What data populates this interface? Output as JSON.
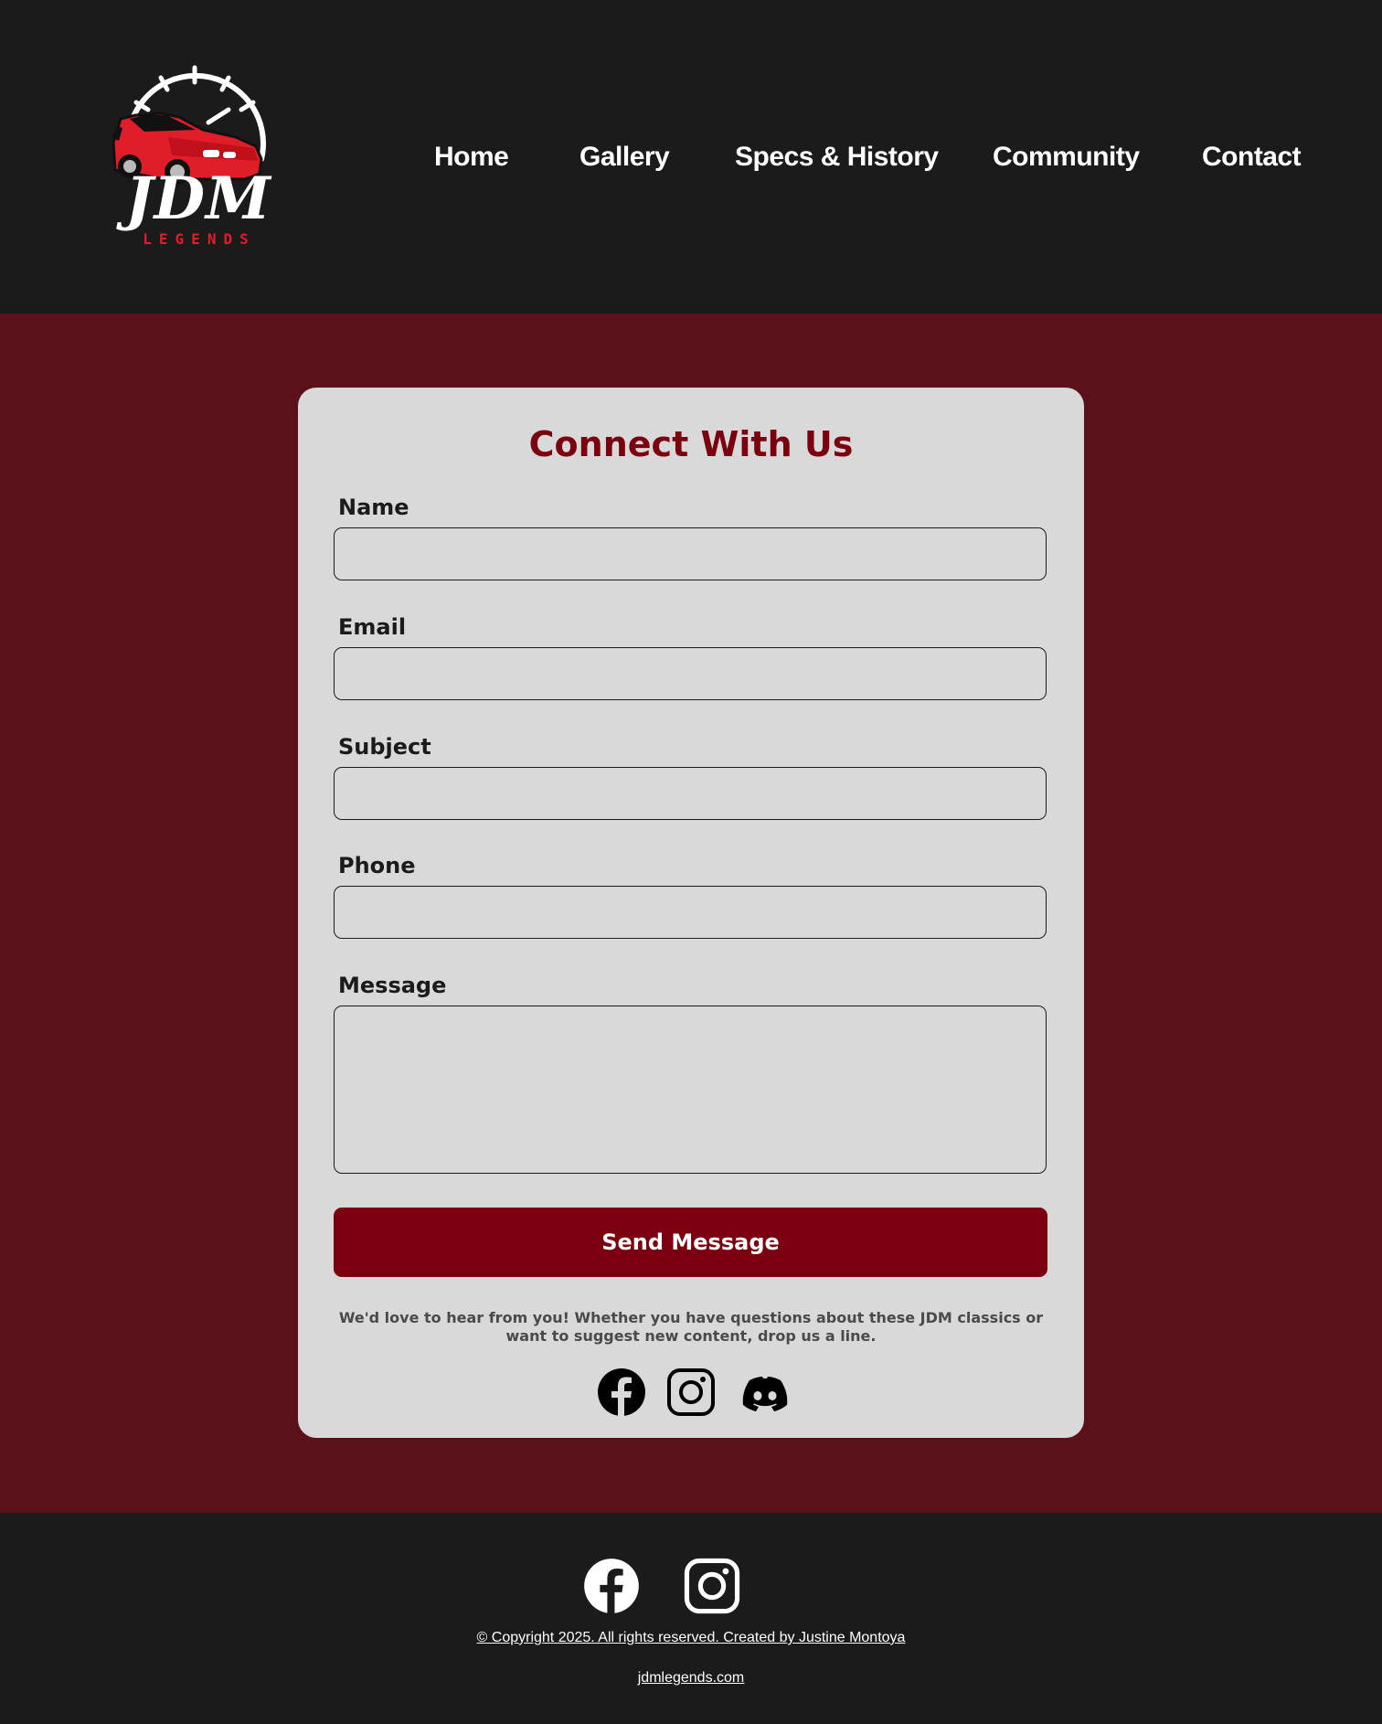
{
  "header": {
    "logo": {
      "title": "JDM",
      "subtitle": "LEGENDS",
      "accent_color": "#e11d2a"
    },
    "nav": [
      {
        "label": "Home"
      },
      {
        "label": "Gallery"
      },
      {
        "label": "Specs & History"
      },
      {
        "label": "Community"
      },
      {
        "label": "Contact"
      }
    ]
  },
  "contact_form": {
    "title": "Connect With Us",
    "fields": {
      "name": {
        "label": "Name",
        "value": "",
        "placeholder": ""
      },
      "email": {
        "label": "Email",
        "value": "",
        "placeholder": ""
      },
      "subject": {
        "label": "Subject",
        "value": "",
        "placeholder": ""
      },
      "phone": {
        "label": "Phone",
        "value": "",
        "placeholder": ""
      },
      "message": {
        "label": "Message",
        "value": "",
        "placeholder": ""
      }
    },
    "submit_label": "Send Message",
    "note": "We'd love to hear from you! Whether you have questions about these JDM classics or want to suggest new content, drop us a line.",
    "social_icons": [
      "facebook-icon",
      "instagram-icon",
      "discord-icon"
    ]
  },
  "footer": {
    "social_icons": [
      "facebook-icon",
      "instagram-icon"
    ],
    "copyright": "© Copyright 2025. All rights reserved. Created by Justine Montoya",
    "site_link": "jdmlegends.com"
  },
  "colors": {
    "header_bg": "#1b1b1b",
    "page_bg": "#5b1119",
    "card_bg": "#d9d9d9",
    "brand_red": "#7a0010"
  }
}
